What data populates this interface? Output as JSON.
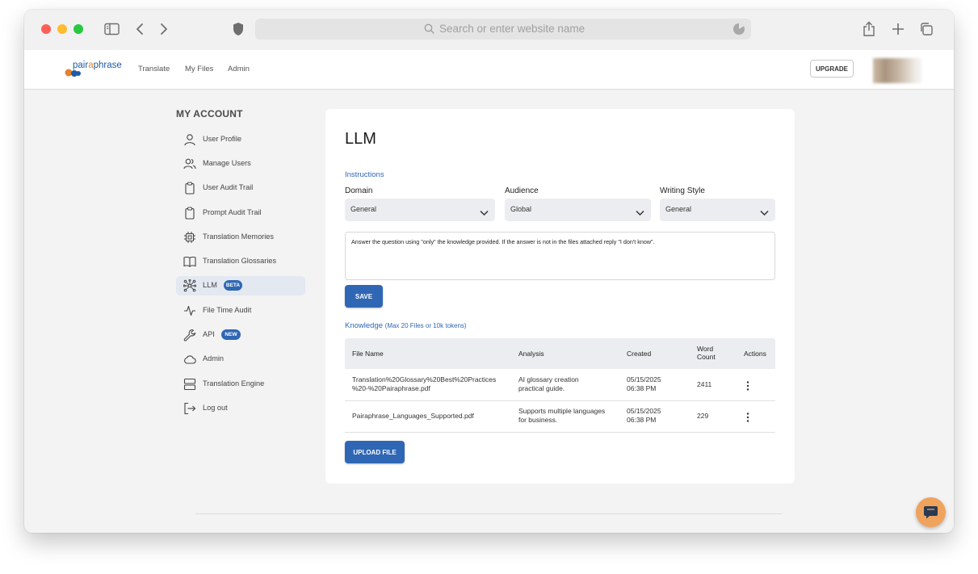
{
  "browser": {
    "url_placeholder": "Search or enter website name"
  },
  "app": {
    "logo": {
      "part1": "pair",
      "part2": "a",
      "part3": "phrase"
    },
    "nav": [
      "Translate",
      "My Files",
      "Admin"
    ],
    "upgrade_label": "UPGRADE"
  },
  "sidebar": {
    "title": "MY ACCOUNT",
    "items": [
      {
        "label": "User Profile"
      },
      {
        "label": "Manage Users"
      },
      {
        "label": "User Audit Trail"
      },
      {
        "label": "Prompt Audit Trail"
      },
      {
        "label": "Translation Memories"
      },
      {
        "label": "Translation Glossaries"
      },
      {
        "label": "LLM",
        "badge": "BETA"
      },
      {
        "label": "File Time Audit"
      },
      {
        "label": "API",
        "badge": "NEW"
      },
      {
        "label": "Admin"
      },
      {
        "label": "Translation Engine"
      },
      {
        "label": "Log out"
      }
    ]
  },
  "main": {
    "title": "LLM",
    "instructions_label": "Instructions",
    "domain": {
      "label": "Domain",
      "value": "General"
    },
    "audience": {
      "label": "Audience",
      "value": "Global"
    },
    "writing_style": {
      "label": "Writing Style",
      "value": "General"
    },
    "prompt_text": "Answer the question using \"only\" the knowledge provided. If the answer is not in the files attached reply \"I don't know\".",
    "save_label": "SAVE",
    "knowledge_label": "Knowledge",
    "knowledge_note": "(Max 20 Files or 10k tokens)",
    "table": {
      "headers": {
        "file_name": "File Name",
        "analysis": "Analysis",
        "created": "Created",
        "word_count_1": "Word",
        "word_count_2": "Count",
        "actions": "Actions"
      },
      "rows": [
        {
          "file_line1": "Translation%20Glossary%20Best%20Practices",
          "file_line2": "%20-%20Pairaphrase.pdf",
          "analysis_line1": "AI glossary creation",
          "analysis_line2": "practical guide.",
          "date": "05/15/2025",
          "time": "06:38 PM",
          "words": "2411"
        },
        {
          "file_line1": "Pairaphrase_Languages_Supported.pdf",
          "file_line2": "",
          "analysis_line1": "Supports multiple languages",
          "analysis_line2": "for business.",
          "date": "05/15/2025",
          "time": "06:38 PM",
          "words": "229"
        }
      ]
    },
    "upload_label": "UPLOAD FILE"
  },
  "colors": {
    "accent": "#2f67b5",
    "chat": "#f0a35d"
  }
}
